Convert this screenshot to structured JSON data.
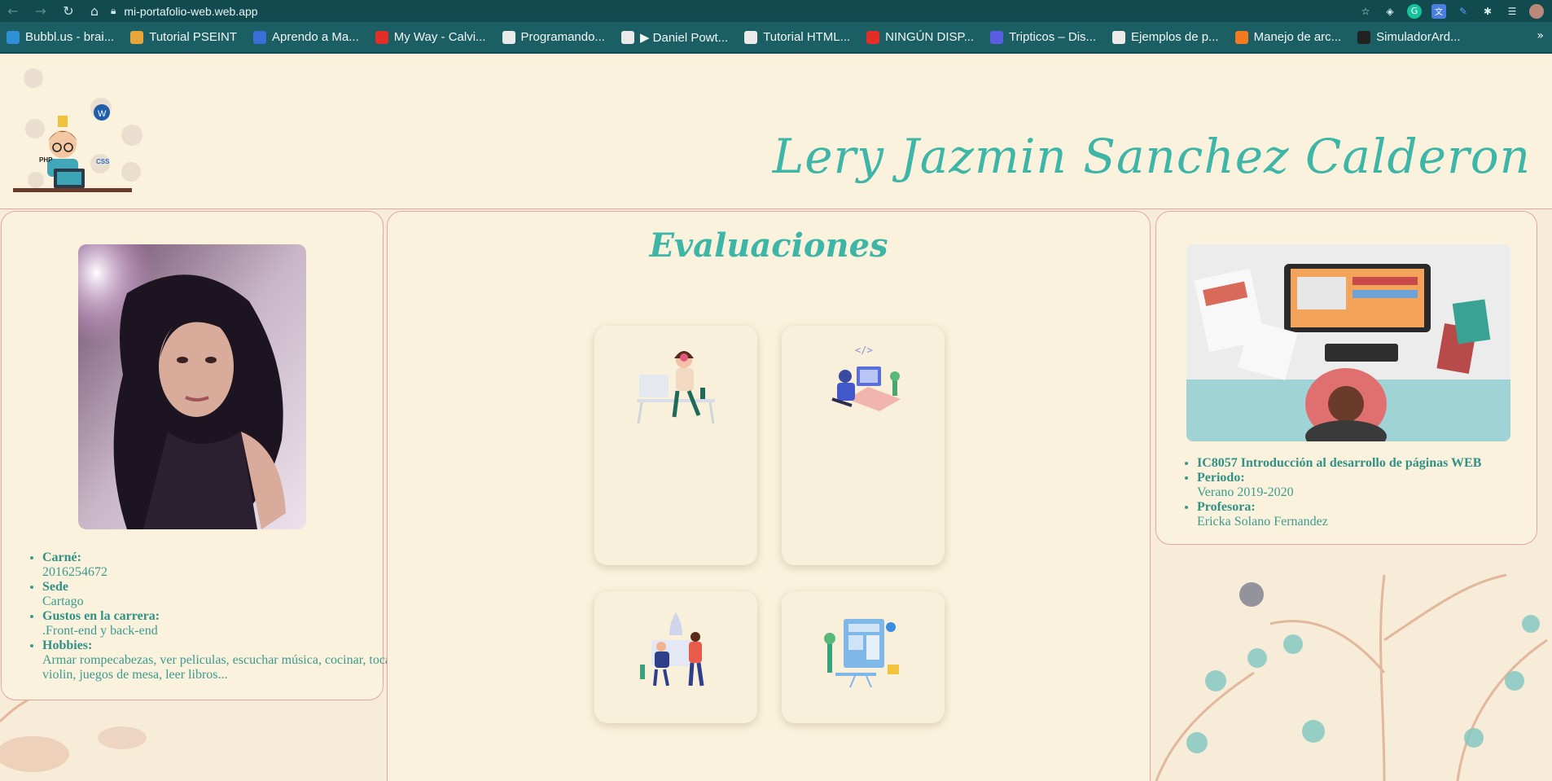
{
  "browser": {
    "url": "mi-portafolio-web.web.app",
    "bookmarks": [
      {
        "label": "Bubbl.us - brai...",
        "color": "#2d8fd5"
      },
      {
        "label": "Tutorial PSEINT",
        "color": "#e8a53a"
      },
      {
        "label": "Aprendo a Ma...",
        "color": "#3b6fd8"
      },
      {
        "label": "My Way - Calvi...",
        "color": "#e52d27"
      },
      {
        "label": "Programando...",
        "color": "#eaeaea"
      },
      {
        "label": "▶ Daniel Powt...",
        "color": "#eaeaea"
      },
      {
        "label": "Tutorial HTML...",
        "color": "#eaeaea"
      },
      {
        "label": "NINGÚN DISP...",
        "color": "#e52d27"
      },
      {
        "label": "Tripticos – Dis...",
        "color": "#5a5ee0"
      },
      {
        "label": "Ejemplos de p...",
        "color": "#eaeaea"
      },
      {
        "label": "Manejo de arc...",
        "color": "#f47a20"
      },
      {
        "label": "SimuladorArd...",
        "color": "#222222"
      }
    ]
  },
  "header": {
    "name": "Lery Jazmin Sanchez Calderon",
    "logo_tags": {
      "php": "PHP",
      "css": "CSS"
    }
  },
  "profile": {
    "items": [
      {
        "label": "Carné:",
        "value": "2016254672"
      },
      {
        "label": "Sede",
        "value": "Cartago"
      },
      {
        "label": "Gustos en la carrera:",
        "value": ".Front-end y back-end"
      },
      {
        "label": "Hobbies:",
        "value": "Armar rompecabezas, ver peliculas, escuchar música, cocinar, tocar violin, juegos de mesa, leer libros..."
      }
    ]
  },
  "evaluaciones": {
    "title": "Evaluaciones"
  },
  "course": {
    "course_name": "IC8057 Introducción al desarrollo de páginas WEB",
    "items": [
      {
        "label": "Periodo:",
        "value": "Verano 2019-2020"
      },
      {
        "label": "Profesora:",
        "value": "Ericka Solano Fernandez"
      }
    ]
  },
  "colors": {
    "accent": "#3db6a7",
    "card_border": "#e7a5a2",
    "page_bg": "#faf2dc",
    "browser_chrome": "#1b5e63"
  }
}
